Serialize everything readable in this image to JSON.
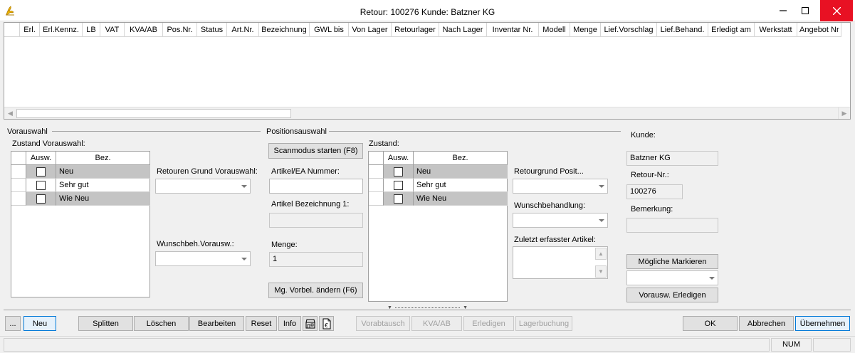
{
  "window": {
    "title": "Retour: 100276 Kunde: Batzner KG",
    "minimize": "—",
    "maximize": "☐",
    "close": "✕"
  },
  "grid": {
    "columns": [
      {
        "label": "Erl.",
        "w": 28
      },
      {
        "label": "Erl.Kennz.",
        "w": 60
      },
      {
        "label": "LB",
        "w": 25
      },
      {
        "label": "VAT",
        "w": 34
      },
      {
        "label": "KVA/AB",
        "w": 54
      },
      {
        "label": "Pos.Nr.",
        "w": 48
      },
      {
        "label": "Status",
        "w": 42
      },
      {
        "label": "Art.Nr.",
        "w": 45
      },
      {
        "label": "Bezeichnung",
        "w": 71
      },
      {
        "label": "GWL bis",
        "w": 55
      },
      {
        "label": "Von Lager",
        "w": 60
      },
      {
        "label": "Retourlager",
        "w": 67
      },
      {
        "label": "Nach Lager",
        "w": 67
      },
      {
        "label": "Inventar Nr.",
        "w": 73
      },
      {
        "label": "Modell",
        "w": 44
      },
      {
        "label": "Menge",
        "w": 43
      },
      {
        "label": "Lief.Vorschlag",
        "w": 79
      },
      {
        "label": "Lief.Behand.",
        "w": 72
      },
      {
        "label": "Erledigt am",
        "w": 65
      },
      {
        "label": "Werkstatt",
        "w": 60
      },
      {
        "label": "Angebot Nr",
        "w": 62
      }
    ]
  },
  "vorauswahl": {
    "group_label": "Vorauswahl",
    "zustand_label": "Zustand Vorauswahl:",
    "table_headers": [
      "Ausw.",
      "Bez."
    ],
    "rows": [
      "Neu",
      "Sehr gut",
      "Wie Neu"
    ],
    "retouren_grund_label": "Retouren Grund Vorauswahl:",
    "wunsch_label": "Wunschbeh.Vorausw.:"
  },
  "positionsauswahl": {
    "group_label": "Positionsauswahl",
    "scan_button": "Scanmodus starten (F8)",
    "artikel_nr_label": "Artikel/EA Nummer:",
    "artikel_bez_label": "Artikel Bezeichnung 1:",
    "menge_label": "Menge:",
    "menge_value": "1",
    "mg_button": "Mg. Vorbel. ändern (F6)",
    "zustand_label": "Zustand:",
    "table_headers": [
      "Ausw.",
      "Bez."
    ],
    "rows": [
      "Neu",
      "Sehr gut",
      "Wie Neu"
    ],
    "retourgrund_label": "Retourgrund Posit...",
    "wunsch_label": "Wunschbehandlung:",
    "zuletzt_label": "Zuletzt erfasster Artikel:"
  },
  "kunde": {
    "kunde_label": "Kunde:",
    "kunde_value": "Batzner KG",
    "retour_nr_label": "Retour-Nr.:",
    "retour_nr_value": "100276",
    "bemerkung_label": "Bemerkung:",
    "moegliche_button": "Mögliche Markieren",
    "vorausw_button": "Vorausw. Erledigen"
  },
  "toolbar": {
    "more": "...",
    "neu": "Neu",
    "splitten": "Splitten",
    "loeschen": "Löschen",
    "bearbeiten": "Bearbeiten",
    "reset": "Reset",
    "info": "Info",
    "vorabtausch": "Vorabtausch",
    "kva_ab": "KVA/AB",
    "erledigen": "Erledigen",
    "lagerbuchung": "Lagerbuchung",
    "ok": "OK",
    "abbrechen": "Abbrechen",
    "uebernehmen": "Übernehmen"
  },
  "statusbar": {
    "num": "NUM"
  }
}
